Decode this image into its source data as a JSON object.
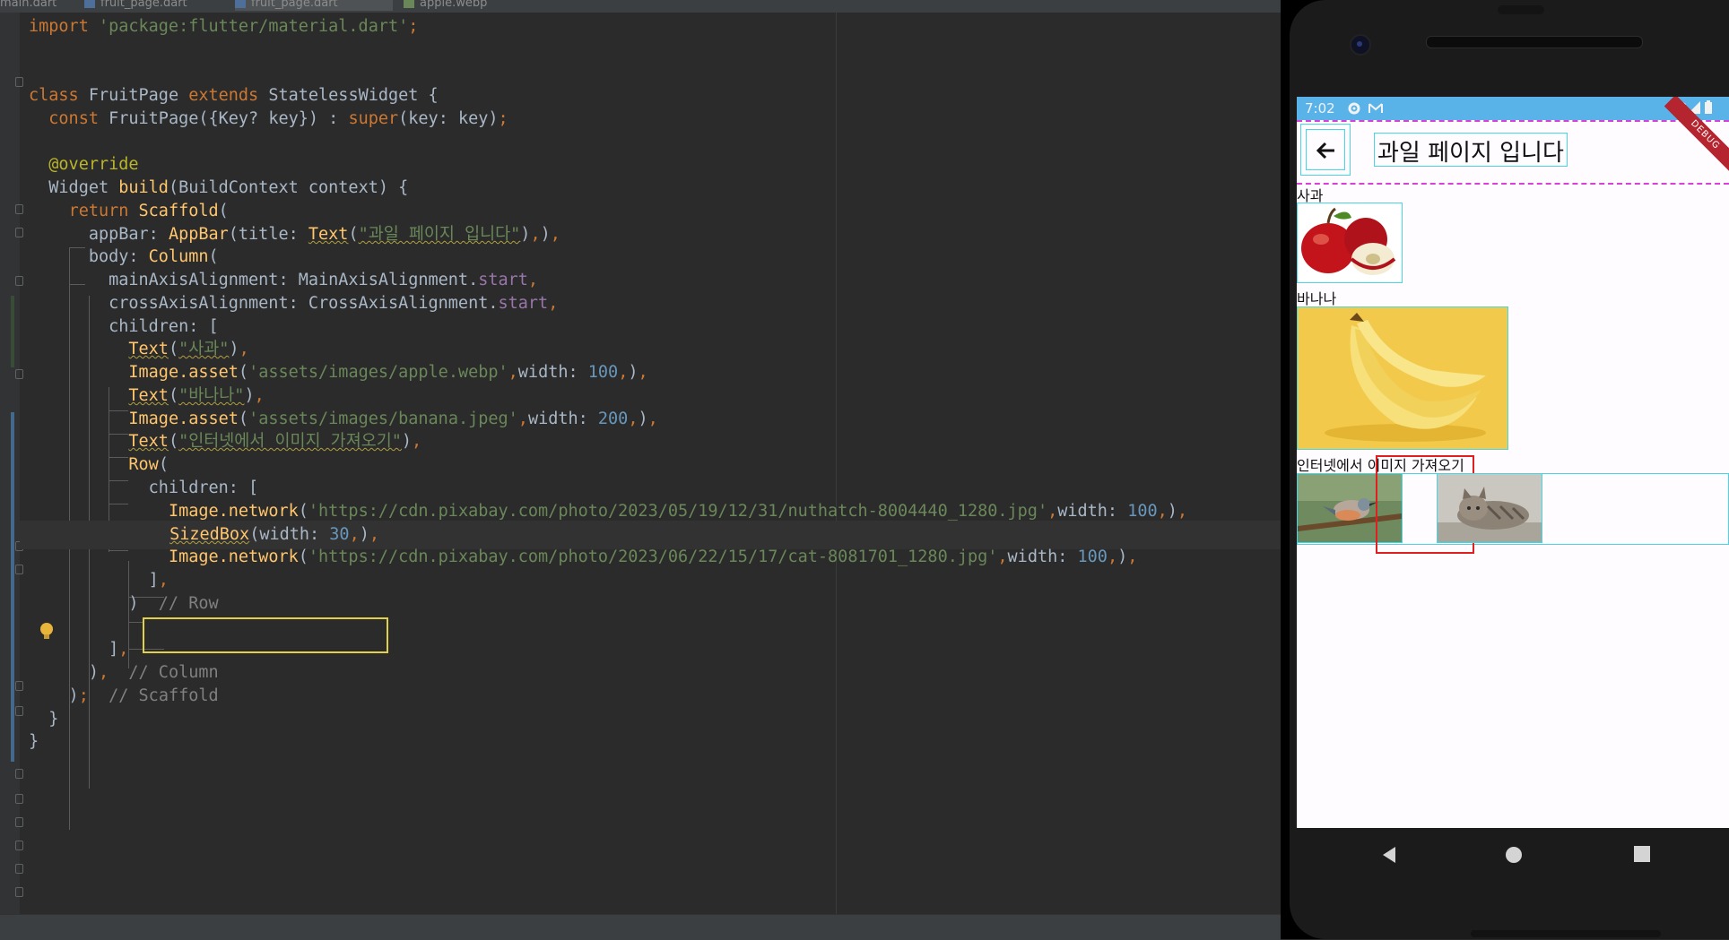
{
  "ide": {
    "tabs": [
      {
        "label": "main.dart",
        "active": false
      },
      {
        "label": "fruit_page.dart",
        "active": false
      },
      {
        "label": "fruit_page.dart",
        "active": true
      },
      {
        "label": "apple.webp",
        "active": false
      }
    ],
    "code_lines": [
      "import 'package:flutter/material.dart';",
      "",
      "class FruitPage extends StatelessWidget {",
      "  const FruitPage({Key? key}) : super(key: key);",
      "",
      "  @override",
      "  Widget build(BuildContext context) {",
      "    return Scaffold(",
      "      appBar: AppBar(title: Text(\"과일 페이지 입니다\"),),",
      "      body: Column(",
      "        mainAxisAlignment: MainAxisAlignment.start,",
      "        crossAxisAlignment: CrossAxisAlignment.start,",
      "        children: [",
      "          Text(\"사과\"),",
      "          Image.asset('assets/images/apple.webp',width: 100,),",
      "          Text(\"바나나\"),",
      "          Image.asset('assets/images/banana.jpeg',width: 200,),",
      "          Text(\"인터넷에서 이미지 가져오기\"),",
      "          Row(",
      "            children: [",
      "              Image.network('https://cdn.pixabay.com/photo/2023/05/19/12/31/nuthatch-8004440_1280.jpg',width: 100,),",
      "              SizedBox(width: 30,),",
      "              Image.network('https://cdn.pixabay.com/photo/2023/06/22/15/17/cat-8081701_1280.jpg',width: 100,),",
      "            ],",
      "          )  // Row",
      "",
      "        ],",
      "      ),  // Column",
      "    );  // Scaffold",
      "  }",
      "}"
    ],
    "highlighted_line": 21,
    "colors": {
      "background": "#2b2b2b",
      "keyword": "#cc7832",
      "string": "#6a8759",
      "number": "#6897bb",
      "function": "#ffc66d",
      "annotation": "#bbb529",
      "comment": "#808080",
      "property": "#9876aa",
      "selection_box": "#e3d04a"
    }
  },
  "phone": {
    "status_time": "7:02",
    "status_icons": [
      "gear-icon",
      "gmail-icon",
      "wifi-icon",
      "signal-icon",
      "battery-icon"
    ],
    "debug_banner": "DEBUG",
    "appbar_title": "과일 페이지 입니다",
    "label_apple": "사과",
    "label_banana": "바나나",
    "label_internet": "인터넷에서 이미지 가져오기",
    "images": [
      "apple-image",
      "banana-image",
      "nuthatch-bird-image",
      "cat-image"
    ],
    "colors": {
      "status_bar": "#5ab3e8",
      "debug_outline": "#47d6e6",
      "sizedbox_highlight": "#e02020"
    }
  }
}
